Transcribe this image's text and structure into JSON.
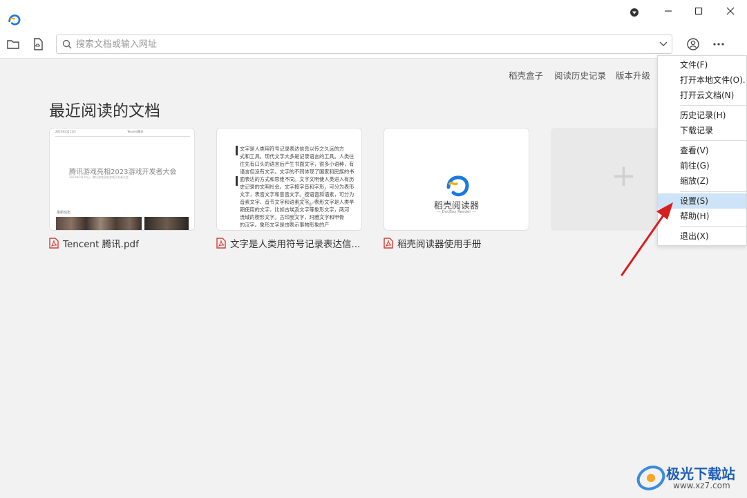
{
  "toolbar": {
    "search_placeholder": "搜索文档或输入网址"
  },
  "top_links": [
    "稻壳盒子",
    "阅读历史记录",
    "版本升级"
  ],
  "section": {
    "title": "最近阅读的文档"
  },
  "documents": [
    {
      "filename": "Tencent 腾讯.pdf",
      "thumb_header_left": "2023年4月11日",
      "thumb_header_center": "Tencent腾讯",
      "thumb_heading": "腾讯游戏亮相2023游戏开发者大会",
      "thumb_sub": "2023年3月20日，腾讯游戏亮相游戏开发者大会",
      "thumb_tag": "最新动态"
    },
    {
      "filename": "文字是人类用符号记录表达信...",
      "thumb_lines": [
        "文字是人类用符号记录表达信息以传之久远的方",
        "式和工具。现代文字大多是记录语言的工具。人类往",
        "往先有口头的语言后产生书面文字，很多小语种，有",
        "语言但没有文字。文字的不同体现了国家和民族的书",
        "面表达的方式和思维不同。文字文明使人类进入有历",
        "史记录的文明社会。文字按字音和字形，可分为表形",
        "文字，表音文字和意音文字。按语音和语素，可分为",
        "音素文字、音节文字和语素文字。表形文字是人类早",
        "期使用的文字，比如古埃及文字等象形文字，两河",
        "流域的楔形文字。古印度文字，玛雅文字和甲骨",
        "的汉字。象形文字是由表示事物形象的产"
      ]
    },
    {
      "filename": "稻壳阅读器使用手册",
      "thumb_brand": "稻壳阅读器",
      "thumb_brand_en": "— DocBox Reader —"
    }
  ],
  "add_card": {
    "symbol": "+"
  },
  "menu": {
    "items": [
      {
        "label": "文件(F)"
      },
      {
        "label": "打开本地文件(O)..."
      },
      {
        "label": "打开云文档(N)"
      },
      {
        "label": "历史记录(H)"
      },
      {
        "label": "下载记录"
      },
      {
        "label": "查看(V)"
      },
      {
        "label": "前往(G)"
      },
      {
        "label": "缩放(Z)"
      },
      {
        "label": "设置(S)"
      },
      {
        "label": "帮助(H)"
      },
      {
        "label": "退出(X)"
      }
    ]
  },
  "watermark": {
    "name": "极光下载站",
    "url": "www.xz7.com"
  },
  "colors": {
    "accent": "#1a7ae0",
    "pdf_red": "#d43c33",
    "annotation_arrow": "#d81e1e",
    "menu_highlight": "#cde3f7"
  }
}
